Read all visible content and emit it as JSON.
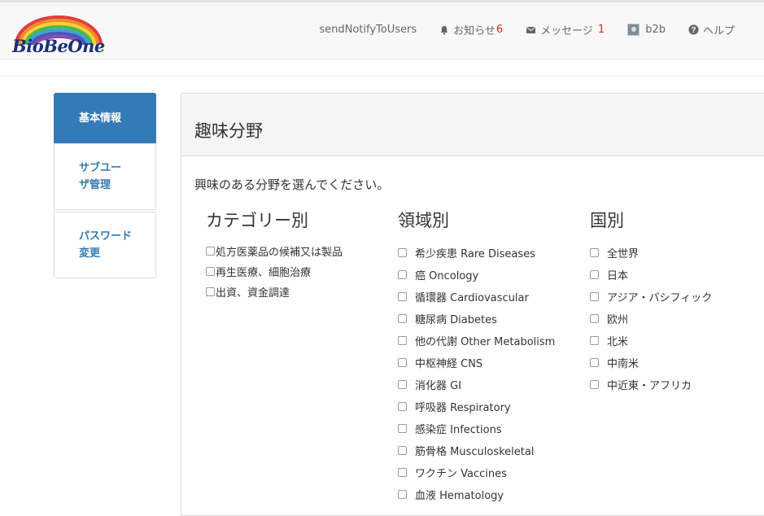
{
  "header": {
    "logo_text": "BioBeOne",
    "nav": {
      "user_notify": "sendNotifyToUsers",
      "notifications_label": "お知らせ",
      "notifications_count": "6",
      "messages_label": "メッセージ",
      "messages_count": "1",
      "user_label": "b2b",
      "help_label": "ヘルプ"
    }
  },
  "sidebar": {
    "items": [
      {
        "label": "基本情報",
        "active": true
      },
      {
        "label_line1": "サブユー",
        "label_line2": "ザ管理"
      },
      {
        "label_line1": "パスワード",
        "label_line2": "変更"
      }
    ]
  },
  "main": {
    "title": "趣味分野",
    "intro": "興味のある分野を選んでください。",
    "columns": [
      {
        "heading": "カテゴリー別",
        "options": [
          "処方医薬品の候補又は製品",
          "再生医療、細胞治療",
          "出資、資金調達"
        ]
      },
      {
        "heading": "領域別",
        "options": [
          "希少疾患 Rare Diseases",
          "癌 Oncology",
          "循環器 Cardiovascular",
          "糖尿病 Diabetes",
          "他の代謝 Other Metabolism",
          "中枢神経 CNS",
          "消化器 GI",
          "呼吸器 Respiratory",
          "感染症 Infections",
          "筋骨格 Musculoskeletal",
          "ワクチン Vaccines",
          "血液 Hematology"
        ]
      },
      {
        "heading": "国別",
        "options": [
          "全世界",
          "日本",
          "アジア・パシフィック",
          "欧州",
          "北米",
          "中南米",
          "中近東・アフリカ"
        ]
      }
    ]
  },
  "colors": {
    "accent": "#337ab7",
    "badge": "#d9262d",
    "navbar_bg": "#f8f8f8",
    "panel_head_bg": "#f5f5f5"
  },
  "icons": [
    "rainbow-logo-icon",
    "bell-icon",
    "envelope-icon",
    "avatar",
    "question-circle-icon"
  ]
}
